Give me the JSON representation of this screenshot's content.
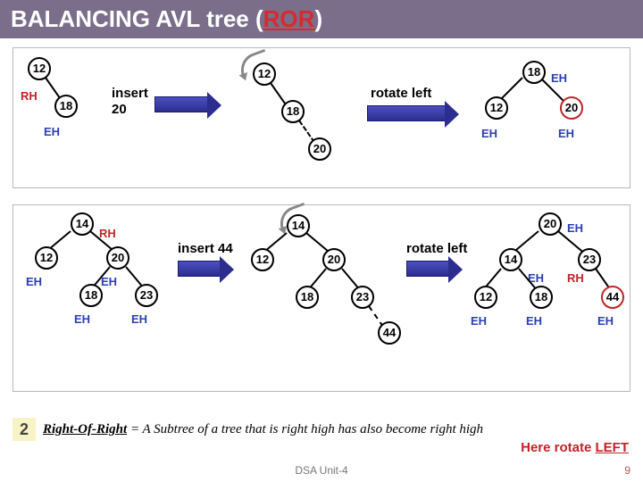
{
  "header": {
    "title_pre": "BALANCING AVL tree (",
    "title_ror": "ROR",
    "title_post": ")"
  },
  "panel1": {
    "tree_a": {
      "n12": "12",
      "n18": "18",
      "lbl_rh": "RH",
      "lbl_eh": "EH"
    },
    "action1": {
      "insert": "insert",
      "val": "20"
    },
    "tree_b": {
      "n12": "12",
      "n18": "18",
      "n20": "20"
    },
    "action2": "rotate left",
    "tree_c": {
      "n18": "18",
      "n12": "12",
      "n20": "20",
      "lbl_eh_top": "EH",
      "lbl_eh_l": "EH",
      "lbl_eh_r": "EH"
    }
  },
  "panel2": {
    "tree_a": {
      "n14": "14",
      "n12": "12",
      "n20": "20",
      "n18": "18",
      "n23": "23",
      "lr": "RH",
      "leh1": "EH",
      "leh2": "EH",
      "leh3": "EH",
      "leh4": "EH"
    },
    "action1": {
      "insert": "insert 44"
    },
    "tree_b": {
      "n14": "14",
      "n12": "12",
      "n20": "20",
      "n18": "18",
      "n23": "23",
      "n44": "44"
    },
    "action2": "rotate left",
    "tree_c": {
      "n20": "20",
      "n14": "14",
      "n23": "23",
      "n12": "12",
      "n18": "18",
      "n44": "44",
      "eh_top": "EH",
      "eh_14": "EH",
      "rh_23": "RH",
      "eh12": "EH",
      "eh18": "EH",
      "eh44": "EH"
    }
  },
  "bottom": {
    "num": "2",
    "note_underline": "Right-Of-Right",
    "note_rest": " = A Subtree of a tree that is right high has also become right high",
    "rotate": "Here rotate ",
    "rotate_word": "LEFT"
  },
  "footer": {
    "unit": "DSA Unit-4",
    "slide": "9"
  }
}
